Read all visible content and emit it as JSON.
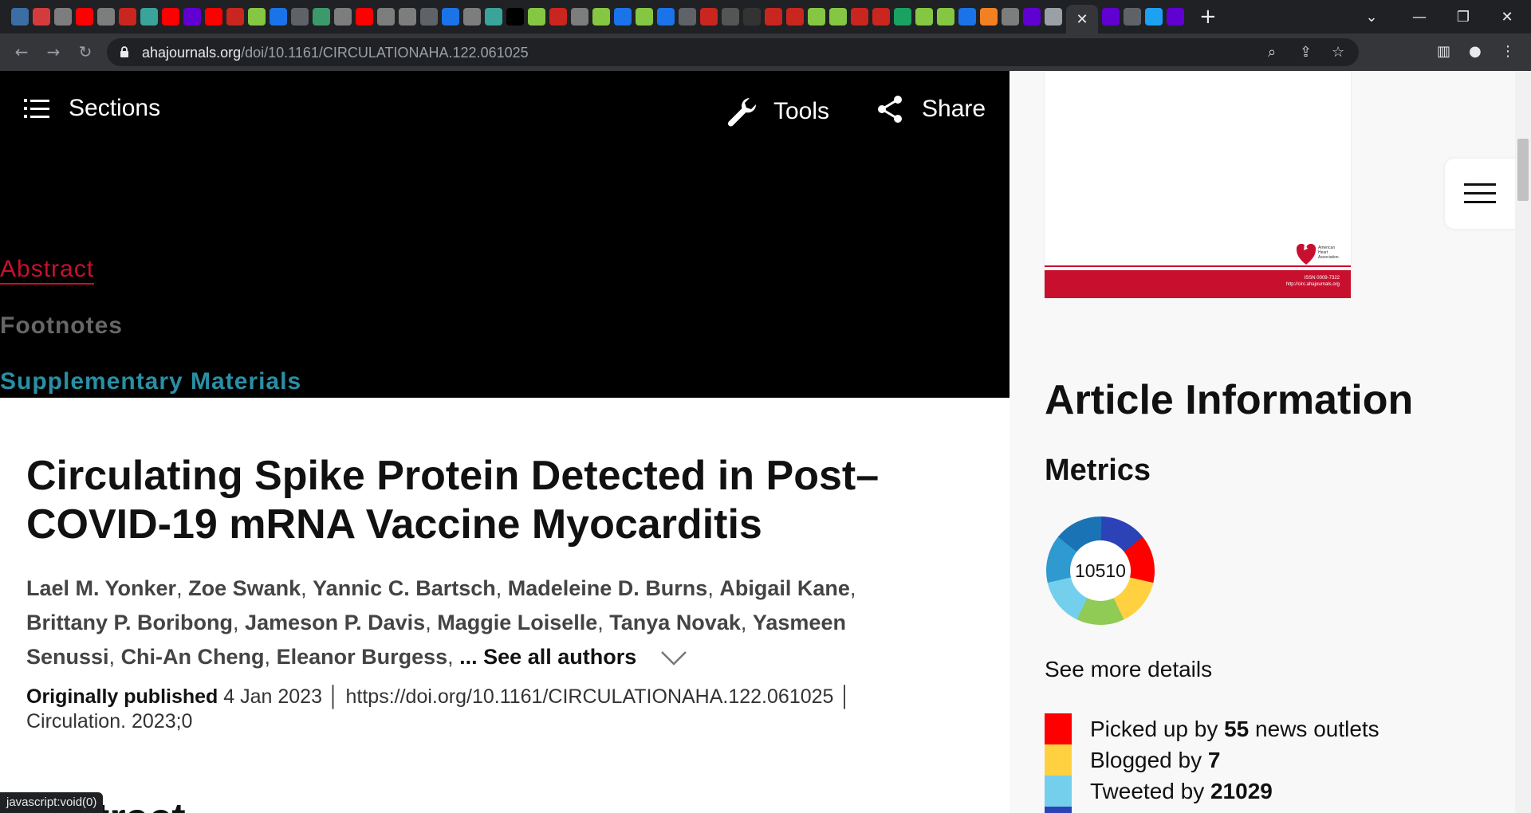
{
  "browser": {
    "tab_favicons": [
      {
        "name": "wasm-globe",
        "color": "#3b6ea5"
      },
      {
        "name": "pinwheel",
        "color": "#d33c3c"
      },
      {
        "name": "globe",
        "color": "#7d7d7d"
      },
      {
        "name": "youtube",
        "color": "#ff0000"
      },
      {
        "name": "globe",
        "color": "#7d7d7d"
      },
      {
        "name": "business-insider",
        "color": "#c8261e"
      },
      {
        "name": "vaccine-globe",
        "color": "#3aa39a"
      },
      {
        "name": "youtube",
        "color": "#ff0000"
      },
      {
        "name": "yahoo",
        "color": "#6001d2"
      },
      {
        "name": "youtube",
        "color": "#ff0000"
      },
      {
        "name": "business-insider",
        "color": "#c8261e"
      },
      {
        "name": "rumble-play",
        "color": "#85c742"
      },
      {
        "name": "shield",
        "color": "#1a73e8"
      },
      {
        "name": "bookmark-arrow",
        "color": "#5f6368"
      },
      {
        "name": "map-thumb",
        "color": "#3c9a6a"
      },
      {
        "name": "globe",
        "color": "#7d7d7d"
      },
      {
        "name": "youtube",
        "color": "#ff0000"
      },
      {
        "name": "globe",
        "color": "#7d7d7d"
      },
      {
        "name": "globe",
        "color": "#7d7d7d"
      },
      {
        "name": "bookmark-arrow",
        "color": "#5f6368"
      },
      {
        "name": "search",
        "color": "#1a73e8"
      },
      {
        "name": "globe",
        "color": "#7d7d7d"
      },
      {
        "name": "vaccine-globe",
        "color": "#3aa39a"
      },
      {
        "name": "n-logo",
        "color": "#000000"
      },
      {
        "name": "rumble-play",
        "color": "#85c742"
      },
      {
        "name": "business-insider",
        "color": "#c8261e"
      },
      {
        "name": "globe",
        "color": "#7d7d7d"
      },
      {
        "name": "rumble-play",
        "color": "#85c742"
      },
      {
        "name": "shield",
        "color": "#1a73e8"
      },
      {
        "name": "rumble-play",
        "color": "#85c742"
      },
      {
        "name": "search",
        "color": "#1a73e8"
      },
      {
        "name": "bookmark-arrow",
        "color": "#5f6368"
      },
      {
        "name": "business-insider",
        "color": "#c8261e"
      },
      {
        "name": "video-thumb",
        "color": "#555555"
      },
      {
        "name": "video-thumb",
        "color": "#333333"
      },
      {
        "name": "business-insider",
        "color": "#c8261e"
      },
      {
        "name": "business-insider",
        "color": "#c8261e"
      },
      {
        "name": "rumble-play",
        "color": "#85c742"
      },
      {
        "name": "rumble-play",
        "color": "#85c742"
      },
      {
        "name": "business-insider",
        "color": "#c8261e"
      },
      {
        "name": "business-insider",
        "color": "#c8261e"
      },
      {
        "name": "g-logo",
        "color": "#1aa260"
      },
      {
        "name": "rumble-play",
        "color": "#85c742"
      },
      {
        "name": "rumble-play",
        "color": "#85c742"
      },
      {
        "name": "search",
        "color": "#1a73e8"
      },
      {
        "name": "stack-overflow",
        "color": "#f48024"
      },
      {
        "name": "globe",
        "color": "#7d7d7d"
      },
      {
        "name": "yahoo-mail",
        "color": "#6001d2"
      },
      {
        "name": "translate",
        "color": "#9aa0a6"
      }
    ],
    "active_tab_close": "✕",
    "tab_favicons_after": [
      {
        "name": "yahoo",
        "color": "#6001d2"
      },
      {
        "name": "bookmark-arrow",
        "color": "#5f6368"
      },
      {
        "name": "twitter",
        "color": "#1da1f2"
      },
      {
        "name": "yahoo",
        "color": "#6001d2"
      }
    ],
    "new_tab": "+",
    "url_host": "ahajournals.org",
    "url_path": "/doi/10.1161/CIRCULATIONAHA.122.061025"
  },
  "header": {
    "sections_label": "Sections",
    "tools_label": "Tools",
    "share_label": "Share"
  },
  "section_links": {
    "abstract": "Abstract",
    "footnotes": "Footnotes",
    "supplementary": "Supplementary Materials"
  },
  "article": {
    "title": "Circulating Spike Protein Detected in Post–COVID-19 mRNA Vaccine Myocarditis",
    "authors": [
      "Lael M. Yonker",
      "Zoe Swank",
      "Yannic C. Bartsch",
      "Madeleine D. Burns",
      "Abigail Kane",
      "Brittany P. Boribong",
      "Jameson P. Davis",
      "Maggie Loiselle",
      "Tanya Novak",
      "Yasmeen Senussi",
      "Chi-An Cheng",
      "Eleanor Burgess"
    ],
    "see_all": "... See all authors",
    "published_label": "Originally published",
    "published_date": "4 Jan 2023",
    "doi_url": "https://doi.org/10.1161/CIRCULATIONAHA.122.061025",
    "citation": "Circulation. 2023;0",
    "next_heading_partial": "tract"
  },
  "sidebar": {
    "cover_issn": "ISSN 0009-7322",
    "cover_url": "http://circ.ahajournals.org",
    "cover_logo_text": "American Heart Association.",
    "article_info_heading": "Article Information",
    "metrics_heading": "Metrics",
    "altmetric_score": "10510",
    "see_more": "See more details",
    "mentions": [
      {
        "pre": "Picked up by ",
        "count": "55",
        "post": " news outlets",
        "color": "#ff0000"
      },
      {
        "pre": "Blogged by ",
        "count": "7",
        "post": "",
        "color": "#ffd140"
      },
      {
        "pre": "Tweeted by ",
        "count": "21029",
        "post": "",
        "color": "#74cfed"
      }
    ]
  },
  "status_bar": "javascript:void(0)"
}
